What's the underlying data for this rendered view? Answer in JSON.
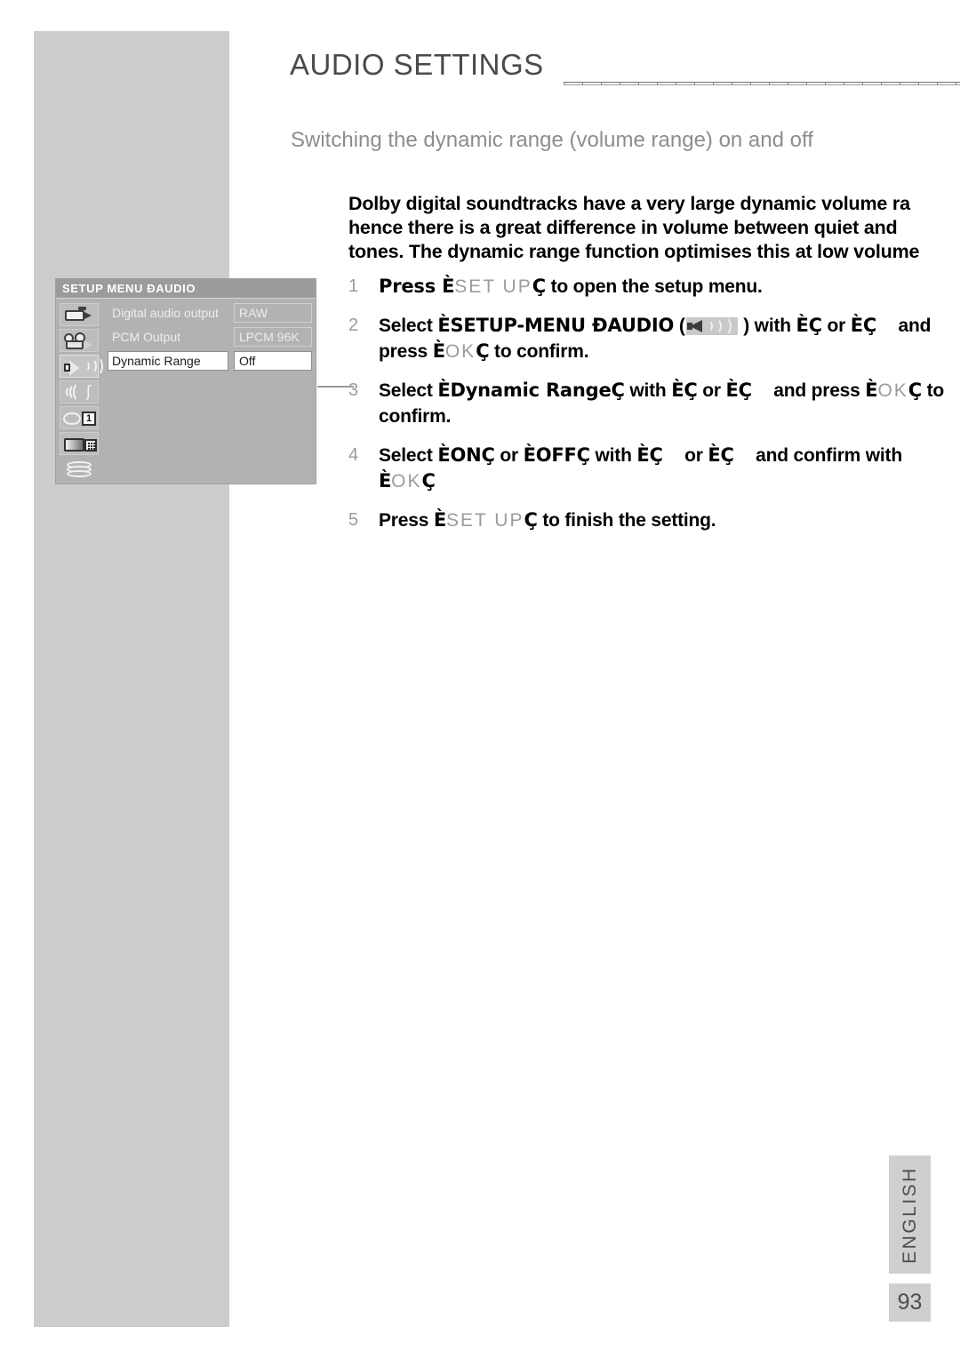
{
  "page": {
    "title": "AUDIO SETTINGS",
    "subheading": "Switching the dynamic range (volume range) on and off",
    "intro": "Dolby digital soundtracks have a very large dynamic volume ra\nhence there is a great difference in volume between quiet and \ntones. The dynamic range function optimises this at low volume",
    "language_tab": "ENGLISH",
    "page_number": "93"
  },
  "steps": [
    {
      "number": "1",
      "parts": [
        {
          "text": "Press ",
          "style": "bold"
        },
        {
          "text": "È",
          "style": "bold"
        },
        {
          "text": "SET UP",
          "style": "keycap"
        },
        {
          "text": "Ç",
          "style": "bold"
        },
        {
          "text": " to open the setup menu.",
          "style": "bold"
        }
      ]
    },
    {
      "number": "2",
      "parts": [
        {
          "text": "Select ",
          "style": "bold"
        },
        {
          "text": "ÈSETUP-MENU ÐAUDIO",
          "style": "bold"
        },
        {
          "text": " (",
          "style": "bold"
        },
        {
          "text": "speaker-icon",
          "style": "icon"
        },
        {
          "text": "  ) with ",
          "style": "bold"
        },
        {
          "text": "È",
          "style": "bold"
        },
        {
          "text": "Ç",
          "style": "bold"
        },
        {
          "text": " or ",
          "style": "bold"
        },
        {
          "text": "È",
          "style": "bold"
        },
        {
          "text": "Ç",
          "style": "bold"
        },
        {
          "text": " and press ",
          "style": "bold"
        },
        {
          "text": "È",
          "style": "bold"
        },
        {
          "text": "OK",
          "style": "keycap"
        },
        {
          "text": "Ç",
          "style": "bold"
        },
        {
          "text": " to confirm.",
          "style": "bold"
        }
      ]
    },
    {
      "number": "3",
      "parts": [
        {
          "text": "Select ",
          "style": "bold"
        },
        {
          "text": "ÈDynamic RangeÇ",
          "style": "bold"
        },
        {
          "text": " with ",
          "style": "bold"
        },
        {
          "text": "È",
          "style": "bold"
        },
        {
          "text": "Ç",
          "style": "bold"
        },
        {
          "text": " or ",
          "style": "bold"
        },
        {
          "text": "È",
          "style": "bold"
        },
        {
          "text": "Ç",
          "style": "bold"
        },
        {
          "text": " and press ",
          "style": "bold"
        },
        {
          "text": "È",
          "style": "bold"
        },
        {
          "text": "OK",
          "style": "keycap"
        },
        {
          "text": "Ç",
          "style": "bold"
        },
        {
          "text": " to confirm.",
          "style": "bold"
        }
      ]
    },
    {
      "number": "4",
      "parts": [
        {
          "text": "Select ",
          "style": "bold"
        },
        {
          "text": "ÈONÇ",
          "style": "bold"
        },
        {
          "text": " or ",
          "style": "bold"
        },
        {
          "text": "ÈOFFÇ",
          "style": "bold"
        },
        {
          "text": " with ",
          "style": "bold"
        },
        {
          "text": "È",
          "style": "bold"
        },
        {
          "text": "Ç",
          "style": "bold"
        },
        {
          "text": " or ",
          "style": "bold"
        },
        {
          "text": "È",
          "style": "bold"
        },
        {
          "text": "Ç",
          "style": "bold"
        },
        {
          "text": " and confirm with ",
          "style": "bold"
        },
        {
          "text": "È",
          "style": "bold"
        },
        {
          "text": "OK",
          "style": "keycap"
        },
        {
          "text": "Ç",
          "style": "bold"
        }
      ]
    },
    {
      "number": "5",
      "parts": [
        {
          "text": "Press ",
          "style": "bold"
        },
        {
          "text": "È",
          "style": "bold"
        },
        {
          "text": "SET UP",
          "style": "keycap"
        },
        {
          "text": "Ç",
          "style": "bold"
        },
        {
          "text": " to finish the setting.",
          "style": "bold"
        }
      ]
    }
  ],
  "osd_menu": {
    "title": "SETUP MENU ÐAUDIO",
    "icons": [
      {
        "name": "camcorder-icon",
        "selected": false
      },
      {
        "name": "film-projector-icon",
        "selected": false
      },
      {
        "name": "speaker-icon",
        "selected": true
      },
      {
        "name": "sound-waves-icon",
        "selected": false
      },
      {
        "name": "disc-preference-icon",
        "selected": false
      },
      {
        "name": "parental-lock-icon",
        "selected": false
      },
      {
        "name": "disc-stack-icon",
        "selected": false
      }
    ],
    "rows": [
      {
        "label": "Digital audio output",
        "value": "RAW",
        "active": false
      },
      {
        "label": "PCM Output",
        "value": "LPCM 96K",
        "active": false
      },
      {
        "label": "Dynamic Range",
        "value": "Off",
        "active": true
      }
    ],
    "card_number": "1"
  },
  "colors": {
    "side_block": "#cccccc",
    "osd_background": "#b2b2b2",
    "osd_title_bar": "#9b9b9b",
    "highlight_row": "#ffffff",
    "tab_background": "#cfcfcf"
  }
}
